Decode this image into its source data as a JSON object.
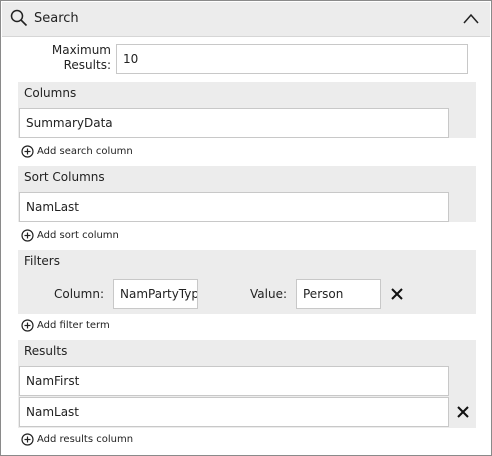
{
  "header": {
    "title": "Search",
    "search_icon": "search-icon",
    "collapse_icon": "chevron-up-icon"
  },
  "max_results": {
    "label_line1": "Maximum",
    "label_line2": "Results:",
    "value": "10"
  },
  "columns": {
    "title": "Columns",
    "items": [
      "SummaryData"
    ],
    "add_label": "Add search column"
  },
  "sort_columns": {
    "title": "Sort Columns",
    "items": [
      "NamLast"
    ],
    "add_label": "Add sort column"
  },
  "filters": {
    "title": "Filters",
    "column_label": "Column:",
    "column_value": "NamPartyType",
    "value_label": "Value:",
    "value_value": "Person",
    "add_label": "Add filter term"
  },
  "results": {
    "title": "Results",
    "items": [
      "NamFirst",
      "NamLast"
    ],
    "add_label": "Add results column"
  }
}
